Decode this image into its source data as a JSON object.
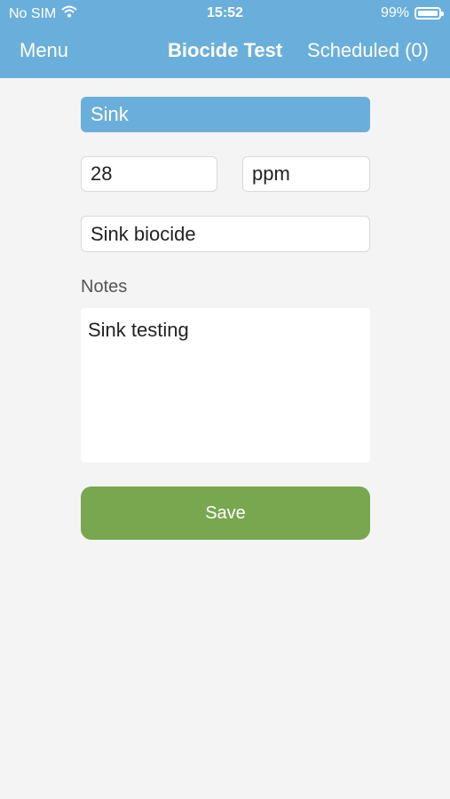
{
  "status_bar": {
    "carrier": "No SIM",
    "time": "15:52",
    "battery": "99%",
    "wifi_icon": "wifi-icon",
    "battery_icon": "battery-icon"
  },
  "nav": {
    "left": "Menu",
    "title": "Biocide Test",
    "right": "Scheduled (0)"
  },
  "form": {
    "location": "Sink",
    "value": "28",
    "unit": "ppm",
    "product": "Sink biocide",
    "notes_label": "Notes",
    "notes_value": "Sink testing",
    "save_label": "Save"
  },
  "colors": {
    "header": "#6aafdb",
    "save_button": "#78a74f",
    "background": "#f4f4f4"
  }
}
